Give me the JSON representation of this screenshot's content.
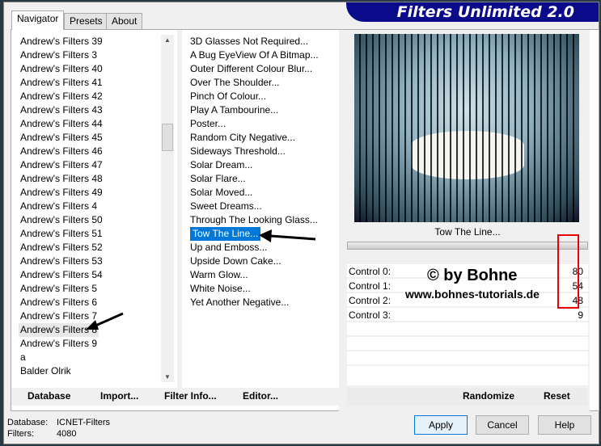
{
  "brand": "Filters Unlimited 2.0",
  "tabs": [
    "Navigator",
    "Presets",
    "About"
  ],
  "categories": [
    "Andrew's Filters 39",
    "Andrew's Filters 3",
    "Andrew's Filters 40",
    "Andrew's Filters 41",
    "Andrew's Filters 42",
    "Andrew's Filters 43",
    "Andrew's Filters 44",
    "Andrew's Filters 45",
    "Andrew's Filters 46",
    "Andrew's Filters 47",
    "Andrew's Filters 48",
    "Andrew's Filters 49",
    "Andrew's Filters 4",
    "Andrew's Filters 50",
    "Andrew's Filters 51",
    "Andrew's Filters 52",
    "Andrew's Filters 53",
    "Andrew's Filters 54",
    "Andrew's Filters 5",
    "Andrew's Filters 6",
    "Andrew's Filters 7",
    "Andrew's Filters 8",
    "Andrew's Filters 9",
    "a",
    "Balder Olrik"
  ],
  "selected_category": "Andrew's Filters 8",
  "filters": [
    "3D Glasses Not Required...",
    "A Bug EyeView Of A Bitmap...",
    "Outer Different Colour Blur...",
    "Over The Shoulder...",
    "Pinch Of Colour...",
    "Play A Tambourine...",
    "Poster...",
    "Random City Negative...",
    "Sideways Threshold...",
    "Solar Dream...",
    "Solar Flare...",
    "Solar Moved...",
    "Sweet Dreams...",
    "Through The Looking Glass...",
    "Tow The Line...",
    "Up and Emboss...",
    "Upside Down Cake...",
    "Warm Glow...",
    "White Noise...",
    "Yet Another Negative..."
  ],
  "selected_filter": "Tow The Line...",
  "preview_title": "Tow The Line...",
  "controls": [
    {
      "label": "Control 0:",
      "value": "80"
    },
    {
      "label": "Control 1:",
      "value": "54"
    },
    {
      "label": "Control 2:",
      "value": "48"
    },
    {
      "label": "Control 3:",
      "value": "9"
    }
  ],
  "watermark": {
    "line1": "© by Bohne",
    "line2": "www.bohnes-tutorials.de"
  },
  "left_buttons": {
    "database": "Database",
    "import": "Import...",
    "filter_info": "Filter Info...",
    "editor": "Editor..."
  },
  "right_buttons": {
    "randomize": "Randomize",
    "reset": "Reset"
  },
  "status": {
    "database_label": "Database:",
    "database_value": "ICNET-Filters",
    "filters_label": "Filters:",
    "filters_value": "4080"
  },
  "dialog_buttons": {
    "apply": "Apply",
    "cancel": "Cancel",
    "help": "Help"
  }
}
